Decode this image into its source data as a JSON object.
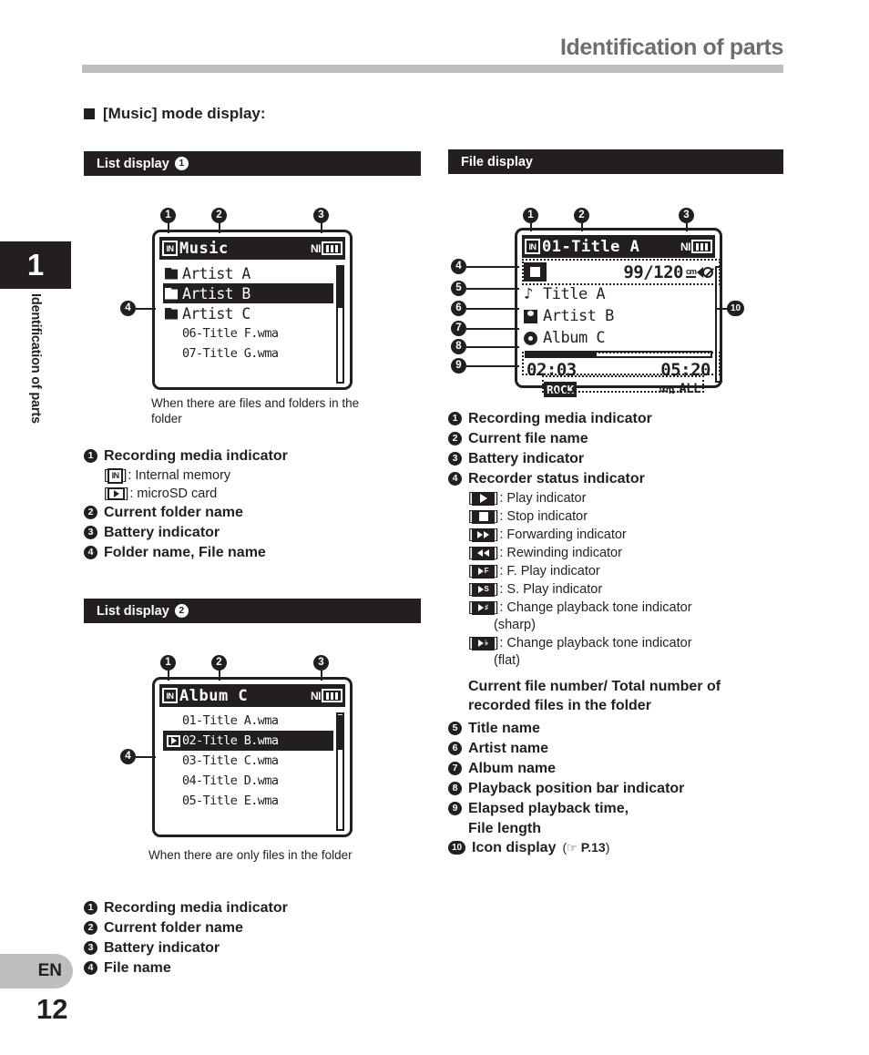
{
  "header": {
    "title": "Identification of parts"
  },
  "sidebar": {
    "chapter_number": "1",
    "chapter_label": "Identification of parts",
    "language": "EN",
    "page_number": "12"
  },
  "mode_heading": "[Music] mode display:",
  "sections": {
    "list1": {
      "bar_label": "List display",
      "bar_number": "1",
      "caption": "When there are files and folders in the folder",
      "lcd": {
        "media_icon": "internal-memory-icon",
        "title": "Music",
        "ni_label": "NI",
        "battery_icon": "battery-full-icon",
        "rows": [
          {
            "glyph": "folder-icon",
            "text": "Artist A",
            "selected": false,
            "small": false
          },
          {
            "glyph": "folder-icon",
            "text": "Artist B",
            "selected": true,
            "small": false
          },
          {
            "glyph": "folder-icon",
            "text": "Artist C",
            "selected": false,
            "small": false
          },
          {
            "glyph": "none",
            "text": "06-Title F.wma",
            "selected": false,
            "small": true
          },
          {
            "glyph": "none",
            "text": "07-Title G.wma",
            "selected": false,
            "small": true
          }
        ],
        "scroll_thumb_pct": 36,
        "scroll_offset_pct": 0
      },
      "callouts": [
        "1",
        "2",
        "3",
        "4"
      ],
      "legend": [
        {
          "num": "1",
          "label": "Recording media indicator",
          "subs": [
            {
              "icon": "internal-memory-icon",
              "text": ": Internal memory"
            },
            {
              "icon": "microsd-icon",
              "text": ": microSD card"
            }
          ]
        },
        {
          "num": "2",
          "label": "Current folder name",
          "subs": []
        },
        {
          "num": "3",
          "label": "Battery indicator",
          "subs": []
        },
        {
          "num": "4",
          "label": "Folder name, File name",
          "subs": []
        }
      ]
    },
    "list2": {
      "bar_label": "List display",
      "bar_number": "2",
      "caption": "When there are only files in the folder",
      "lcd": {
        "media_icon": "internal-memory-icon",
        "title": "Album C",
        "ni_label": "NI",
        "battery_icon": "battery-full-icon",
        "rows": [
          {
            "glyph": "none",
            "text": "01-Title A.wma",
            "selected": false,
            "small": true
          },
          {
            "glyph": "play-icon",
            "text": "02-Title B.wma",
            "selected": true,
            "small": true
          },
          {
            "glyph": "none",
            "text": "03-Title C.wma",
            "selected": false,
            "small": true
          },
          {
            "glyph": "none",
            "text": "04-Title D.wma",
            "selected": false,
            "small": true
          },
          {
            "glyph": "none",
            "text": "05-Title E.wma",
            "selected": false,
            "small": true
          }
        ],
        "scroll_thumb_pct": 30,
        "scroll_offset_pct": 22
      },
      "callouts": [
        "1",
        "2",
        "3",
        "4"
      ],
      "legend": [
        {
          "num": "1",
          "label": "Recording media indicator"
        },
        {
          "num": "2",
          "label": "Current folder name"
        },
        {
          "num": "3",
          "label": "Battery indicator"
        },
        {
          "num": "4",
          "label": "File name"
        }
      ]
    },
    "file": {
      "bar_label": "File display",
      "lcd": {
        "media_icon": "internal-memory-icon",
        "title": "01-Title A",
        "ni_label": "NI",
        "battery_icon": "battery-full-icon",
        "status_icon": "stop-icon",
        "file_counter": "99/120",
        "icons": [
          "cm-icon",
          "mute-icon"
        ],
        "title_name": "Title A",
        "artist_name": "Artist B",
        "album_name": "Album C",
        "progress_pct": 38,
        "elapsed_time": "02:03",
        "file_length": "05:20",
        "eq_tag": "ROCK",
        "repeat_tag": "ALL",
        "shuffle_icon": "shuffle-icon"
      },
      "callouts": [
        "1",
        "2",
        "3",
        "4",
        "5",
        "6",
        "7",
        "8",
        "9",
        "10"
      ],
      "legend": [
        {
          "num": "1",
          "label": "Recording media indicator"
        },
        {
          "num": "2",
          "label": "Current file name"
        },
        {
          "num": "3",
          "label": "Battery indicator"
        },
        {
          "num": "4",
          "label": "Recorder status indicator"
        }
      ],
      "status_list": [
        {
          "icon": "play-icon",
          "text": ": Play indicator"
        },
        {
          "icon": "stop-icon",
          "text": ": Stop indicator"
        },
        {
          "icon": "forward-icon",
          "text": ": Forwarding indicator"
        },
        {
          "icon": "rewind-icon",
          "text": ": Rewinding indicator"
        },
        {
          "icon": "fast-play-icon",
          "text": ": F. Play indicator"
        },
        {
          "icon": "slow-play-icon",
          "text": ": S. Play indicator"
        },
        {
          "icon": "tone-sharp-icon",
          "text": ": Change playback tone indicator"
        },
        {
          "icon": "tone-flat-icon",
          "text": ": Change playback tone indicator"
        }
      ],
      "sharp_cont": "(sharp)",
      "flat_cont": "(flat)",
      "file_number_block": "Current file number/ Total number of recorded files in the folder",
      "legend2": [
        {
          "num": "5",
          "label": "Title name"
        },
        {
          "num": "6",
          "label": "Artist name"
        },
        {
          "num": "7",
          "label": "Album name"
        },
        {
          "num": "8",
          "label": "Playback position bar indicator"
        },
        {
          "num": "9",
          "label": "Elapsed playback time,"
        },
        {
          "num": "10",
          "label": "Icon display"
        }
      ],
      "elapsed_cont": "File length",
      "icon_ref": "P.13"
    }
  }
}
